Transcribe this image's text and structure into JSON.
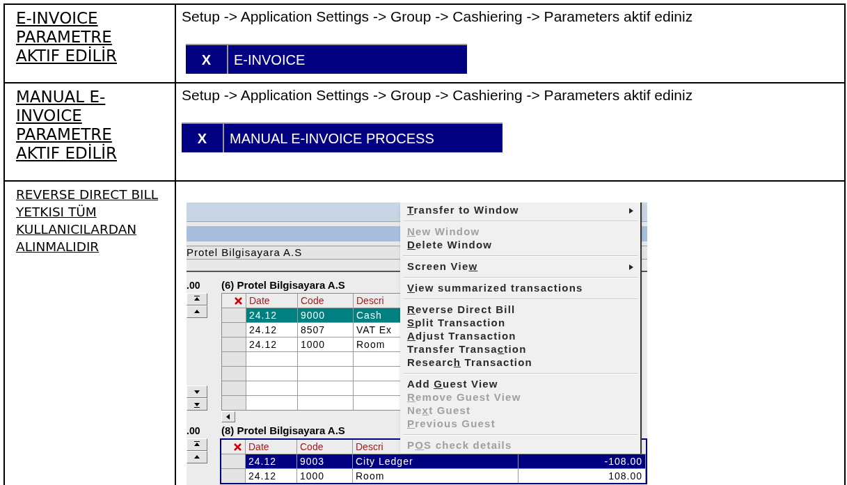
{
  "rows": [
    {
      "title": "E-INVOICE PARAMETRE AKTIF EDİLİR",
      "instruction": "Setup -> Application Settings -> Group -> Cashiering -> Parameters aktif ediniz",
      "parameter": {
        "mark": "X",
        "label": "E-INVOICE"
      }
    },
    {
      "title": "MANUAL E-INVOICE PARAMETRE AKTIF EDİLİR",
      "instruction": "Setup -> Application Settings -> Group -> Cashiering -> Parameters aktif ediniz",
      "parameter": {
        "mark": "X",
        "label": "MANUAL E-INVOICE PROCESS"
      }
    },
    {
      "title": "REVERSE DIRECT BILL YETKISI TÜM KULLANICILARDAN ALINMALIDIR",
      "screenshot": {
        "account_field": "Protel Bilgisayara A.S",
        "panels": [
          {
            "balance": ".00",
            "title": "(6) Protel Bilgisayara A.S",
            "focused": false,
            "columns": [
              "Date",
              "Code",
              "Descri"
            ],
            "rows": [
              {
                "cells": [
                  "24.12",
                  "9000",
                  "Cash"
                ],
                "selected": true
              },
              {
                "cells": [
                  "24.12",
                  "8507",
                  "VAT Ex"
                ],
                "selected": false
              },
              {
                "cells": [
                  "24.12",
                  "1000",
                  "Room"
                ],
                "selected": false
              }
            ]
          },
          {
            "balance": ".00",
            "title": "(8) Protel Bilgisayara A.S",
            "focused": true,
            "columns": [
              "Date",
              "Code",
              "Descri"
            ],
            "rows": [
              {
                "cells": [
                  "24.12",
                  "9003",
                  "City Ledger",
                  "-108.00"
                ],
                "selected": true
              },
              {
                "cells": [
                  "24.12",
                  "1000",
                  "Room",
                  "108.00"
                ],
                "selected": false
              }
            ]
          }
        ],
        "context_menu": [
          {
            "kind": "item",
            "key": "T",
            "after": "ransfer to Window",
            "disabled": false,
            "submenu": true
          },
          {
            "kind": "separator"
          },
          {
            "kind": "item",
            "key": "N",
            "after": "ew Window",
            "disabled": true,
            "submenu": false
          },
          {
            "kind": "item",
            "key": "D",
            "after": "elete Window",
            "disabled": false,
            "submenu": false
          },
          {
            "kind": "separator"
          },
          {
            "kind": "item",
            "before": "Screen Vie",
            "key": "w",
            "disabled": false,
            "submenu": true
          },
          {
            "kind": "separator"
          },
          {
            "kind": "item",
            "key": "V",
            "after": "iew summarized transactions",
            "disabled": false,
            "submenu": false
          },
          {
            "kind": "separator"
          },
          {
            "kind": "item",
            "key": "R",
            "after": "everse Direct Bill",
            "disabled": false,
            "submenu": false
          },
          {
            "kind": "item",
            "key": "S",
            "after": "plit Transaction",
            "disabled": false,
            "submenu": false
          },
          {
            "kind": "item",
            "key": "A",
            "after": "djust Transaction",
            "disabled": false,
            "submenu": false
          },
          {
            "kind": "item",
            "before": "Transfer Transa",
            "key": "c",
            "after": "tion",
            "disabled": false,
            "submenu": false
          },
          {
            "kind": "item",
            "before": "Researc",
            "key": "h",
            "after": " Transaction",
            "disabled": false,
            "submenu": false
          },
          {
            "kind": "separator"
          },
          {
            "kind": "item",
            "before": "Add ",
            "key": "G",
            "after": "uest View",
            "disabled": false,
            "submenu": false
          },
          {
            "kind": "item",
            "key": "R",
            "after": "emove Guest View",
            "disabled": true,
            "submenu": false
          },
          {
            "kind": "item",
            "before": "Ne",
            "key": "x",
            "after": "t Guest",
            "disabled": true,
            "submenu": false
          },
          {
            "kind": "item",
            "key": "P",
            "after": "revious Guest",
            "disabled": true,
            "submenu": false
          },
          {
            "kind": "separator"
          },
          {
            "kind": "item",
            "before": "P",
            "key": "O",
            "after": "S check details",
            "disabled": true,
            "submenu": false
          }
        ]
      }
    }
  ]
}
